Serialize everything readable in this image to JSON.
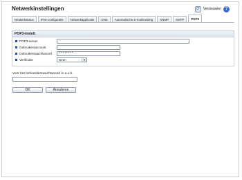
{
  "header": {
    "title": "Netwerkinstellingen",
    "refresh_label": "Vernieuwen",
    "help_glyph": "?"
  },
  "tabs": [
    {
      "label": "Netwerkstatus",
      "active": false
    },
    {
      "label": "IPv6-configuratie",
      "active": false
    },
    {
      "label": "Netwerkapplicatie",
      "active": false
    },
    {
      "label": "DNS",
      "active": false
    },
    {
      "label": "Automatische E-mailmelding",
      "active": false
    },
    {
      "label": "SNMP",
      "active": false
    },
    {
      "label": "SMTP",
      "active": false
    },
    {
      "label": "POP3",
      "active": true
    }
  ],
  "section": {
    "title": "POP3-instell.",
    "fields": [
      {
        "label": "POP3-server",
        "value": ""
      },
      {
        "label": "Gebruikersaccount",
        "value": ""
      },
      {
        "label": "Gebruikerswachtwoord",
        "value": "********"
      },
      {
        "label": "Verificatie",
        "value": "Geen"
      }
    ]
  },
  "admin": {
    "label": "Voer het beheerderswachtwoord in a.u.b.",
    "value": ""
  },
  "buttons": {
    "ok": "OK",
    "cancel": "Annuleren"
  },
  "colors": {
    "accent": "#1e4f9c",
    "border": "#c9d0da"
  }
}
